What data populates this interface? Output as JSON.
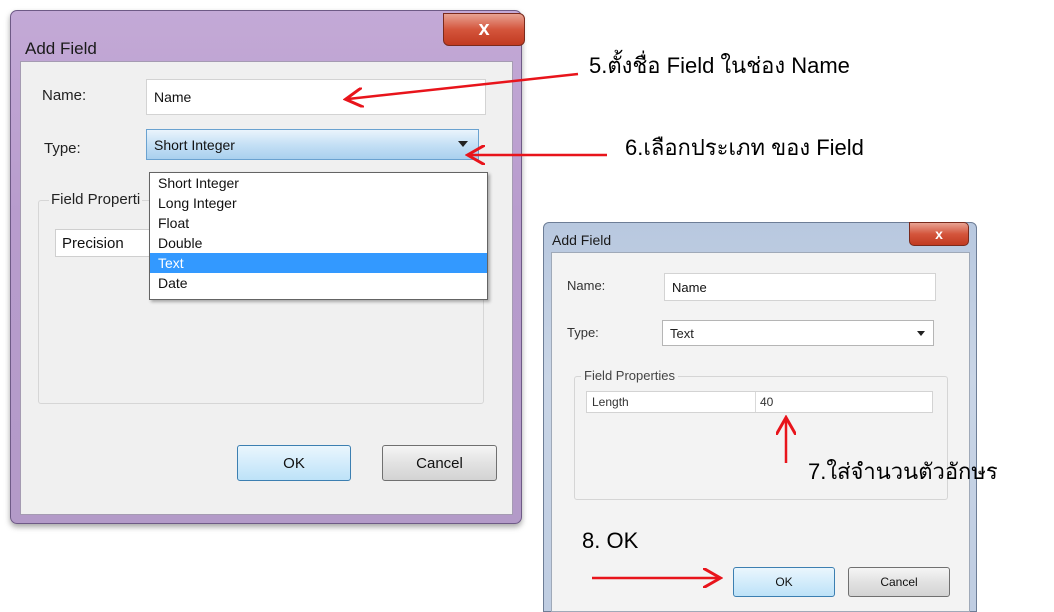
{
  "dialog1": {
    "title": "Add Field",
    "close_glyph": "x",
    "name_label": "Name:",
    "name_value": "Name",
    "type_label": "Type:",
    "type_value": "Short Integer",
    "field_properties_label": "Field Properti",
    "precision_label": "Precision",
    "type_options": [
      "Short Integer",
      "Long Integer",
      "Float",
      "Double",
      "Text",
      "Date"
    ],
    "selected_option": "Text",
    "ok_label": "OK",
    "cancel_label": "Cancel"
  },
  "dialog2": {
    "title": "Add Field",
    "close_glyph": "x",
    "name_label": "Name:",
    "name_value": "Name",
    "type_label": "Type:",
    "type_value": "Text",
    "field_properties_label": "Field Properties",
    "length_label": "Length",
    "length_value": "40",
    "ok_label": "OK",
    "cancel_label": "Cancel"
  },
  "annotations": {
    "step5": "5.ตั้งชื่อ Field ในช่อง Name",
    "step6": "6.เลือกประเภท ของ Field",
    "step7": "7.ใส่จำนวนตัวอักษร",
    "step8": "8. OK"
  },
  "colors": {
    "arrow": "#e8141b",
    "list_highlight": "#3399ff",
    "close_button": "#d4553c"
  }
}
